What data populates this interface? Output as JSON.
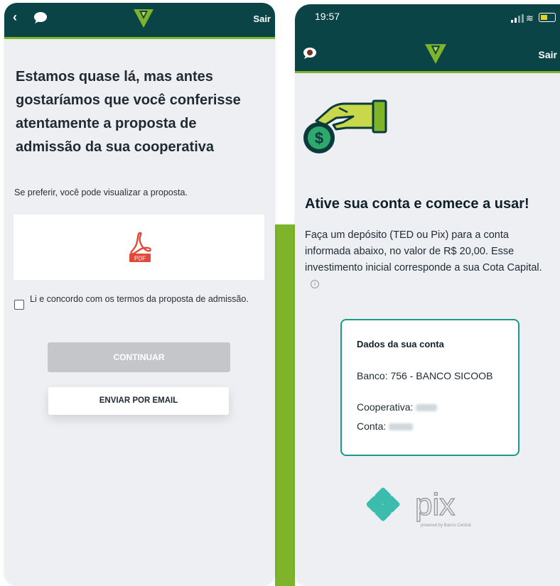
{
  "left": {
    "header": {
      "back": "‹",
      "exit": "Sair"
    },
    "title": "Estamos quase lá, mas antes gostaríamos que você conferisse atentamente a proposta de admissão da sua cooperativa",
    "subtitle": "Se preferir, você pode visualizar a proposta.",
    "pdf_label": "PDF",
    "terms": "Li e concordo com os termos da proposta de admissão.",
    "continue_button": "CONTINUAR",
    "email_button": "ENVIAR POR EMAIL"
  },
  "right": {
    "status": {
      "time": "19:57"
    },
    "header": {
      "exit": "Sair"
    },
    "title": "Ative sua conta e comece a usar!",
    "text": "Faça um depósito (TED ou Pix) para a conta informada abaixo, no valor de R$ 20,00. Esse investimento inicial corresponde a sua Cota Capital.",
    "card": {
      "title": "Dados da sua conta",
      "bank": "Banco: 756 - BANCO SICOOB",
      "coop_label": "Cooperativa:",
      "account_label": "Conta:"
    },
    "pix": {
      "wordmark": "pix",
      "tagline": "powered by Banco Central"
    }
  },
  "colors": {
    "header": "#0b4447",
    "accent": "#7db42a",
    "teal": "#1a9b8e"
  }
}
